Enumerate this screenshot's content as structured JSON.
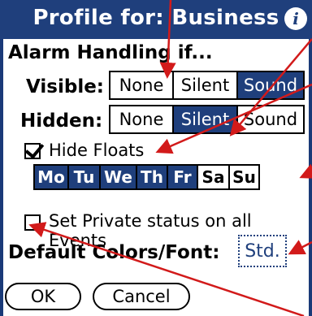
{
  "title": "Profile for: Business",
  "section_title": "Alarm Handling if...",
  "visible": {
    "label": "Visible:",
    "options": [
      "None",
      "Silent",
      "Sound"
    ],
    "selected": "Sound"
  },
  "hidden": {
    "label": "Hidden:",
    "options": [
      "None",
      "Silent",
      "Sound"
    ],
    "selected": "Silent"
  },
  "hide_floats": {
    "label": "Hide Floats",
    "checked": true
  },
  "days": [
    {
      "label": "Mo",
      "selected": true
    },
    {
      "label": "Tu",
      "selected": true
    },
    {
      "label": "We",
      "selected": true
    },
    {
      "label": "Th",
      "selected": true
    },
    {
      "label": "Fr",
      "selected": true
    },
    {
      "label": "Sa",
      "selected": false
    },
    {
      "label": "Su",
      "selected": false
    }
  ],
  "private_status": {
    "label": "Set Private status on all Events",
    "checked": false
  },
  "default_colors": {
    "label": "Default Colors/Font:",
    "button": "Std."
  },
  "buttons": {
    "ok": "OK",
    "cancel": "Cancel"
  },
  "colors": {
    "title_bar": "#1f3f7c",
    "selected": "#1f3f7c",
    "annotation_arrow": "#d21a1a"
  },
  "icons": {
    "info": "info-icon",
    "check": "checkmark-icon"
  }
}
